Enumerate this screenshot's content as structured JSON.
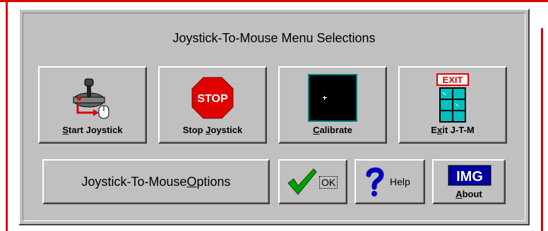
{
  "dialog": {
    "title": "Joystick-To-Mouse Menu Selections"
  },
  "buttons": {
    "start_joystick": {
      "prefix": "",
      "accel": "S",
      "suffix": "tart Joystick",
      "icon": "joystick-icon"
    },
    "stop_joystick": {
      "prefix": "Stop ",
      "accel": "J",
      "suffix": "oystick",
      "icon": "stop-sign-icon",
      "sign_text": "STOP"
    },
    "calibrate": {
      "prefix": "",
      "accel": "C",
      "suffix": "alibrate",
      "icon": "calibrate-screen-icon"
    },
    "exit": {
      "prefix": "E",
      "accel": "x",
      "suffix": "it J-T-M",
      "icon": "exit-door-icon",
      "sign_text": "EXIT"
    },
    "options": {
      "prefix": "Joystick-To-Mouse ",
      "accel": "O",
      "suffix": "ptions"
    },
    "ok": {
      "label": "OK",
      "icon": "checkmark-icon"
    },
    "help": {
      "label": "Help",
      "icon": "question-mark-icon"
    },
    "about": {
      "prefix": "",
      "accel": "A",
      "suffix": "bout",
      "icon": "img-logo-icon",
      "logo_text": "IMG"
    }
  },
  "colors": {
    "face": "#c0c0c0",
    "accent_red": "#e00000",
    "help_blue": "#0000c0",
    "ok_green": "#00a000"
  }
}
